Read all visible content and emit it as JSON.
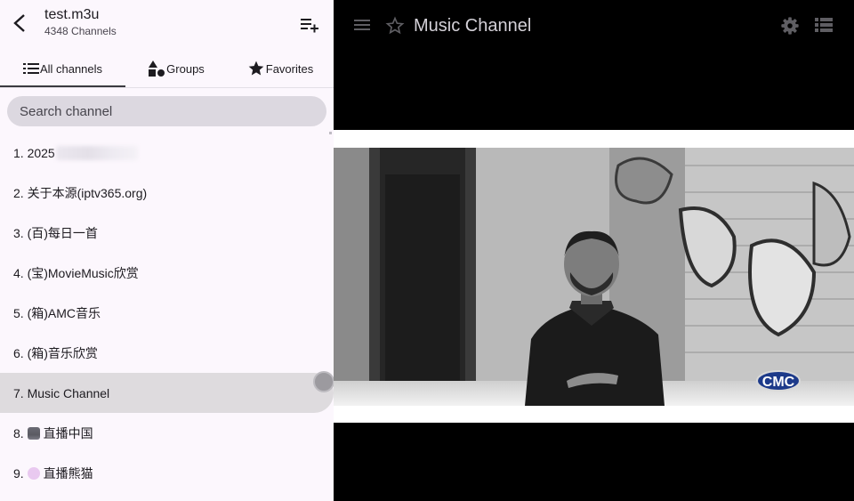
{
  "sidebar": {
    "title": "test.m3u",
    "subtitle": "4348 Channels",
    "icons": {
      "back": "arrow-back-icon",
      "add": "playlist-add-icon"
    },
    "tabs": [
      {
        "label": "All channels",
        "icon": "list-icon",
        "active": true
      },
      {
        "label": "Groups",
        "icon": "category-shapes-icon",
        "active": false
      },
      {
        "label": "Favorites",
        "icon": "star-filled-icon",
        "active": false
      }
    ],
    "search": {
      "placeholder": "Search channel",
      "value": ""
    },
    "channels": [
      {
        "label": "1. 2025"
      },
      {
        "label": "2. 关于本源(iptv365.org)"
      },
      {
        "label": "3. (百)每日一首"
      },
      {
        "label": "4. (宝)MovieMusic欣赏"
      },
      {
        "label": "5. (箱)AMC音乐"
      },
      {
        "label": "6. (箱)音乐欣赏"
      },
      {
        "label": "7. Music Channel"
      },
      {
        "label": "直播中国",
        "number": "8.",
        "emoji": "video-camera-icon"
      },
      {
        "label": "直播熊猫",
        "number": "9.",
        "emoji": "panda-icon"
      }
    ],
    "selected_index": 6
  },
  "player": {
    "title": "Music Channel",
    "icons": {
      "menu": "menu-icon",
      "favorite": "star-outline-icon",
      "settings": "gear-icon",
      "list": "list-view-icon"
    },
    "watermark": "CMC"
  },
  "colors": {
    "sidebar_bg": "#fcf7fd",
    "selected_bg": "#dedbde",
    "search_bg": "#dcd8e0",
    "player_bg": "#000000",
    "player_icon": "#5f5e63",
    "player_title": "#d4d1d8"
  }
}
